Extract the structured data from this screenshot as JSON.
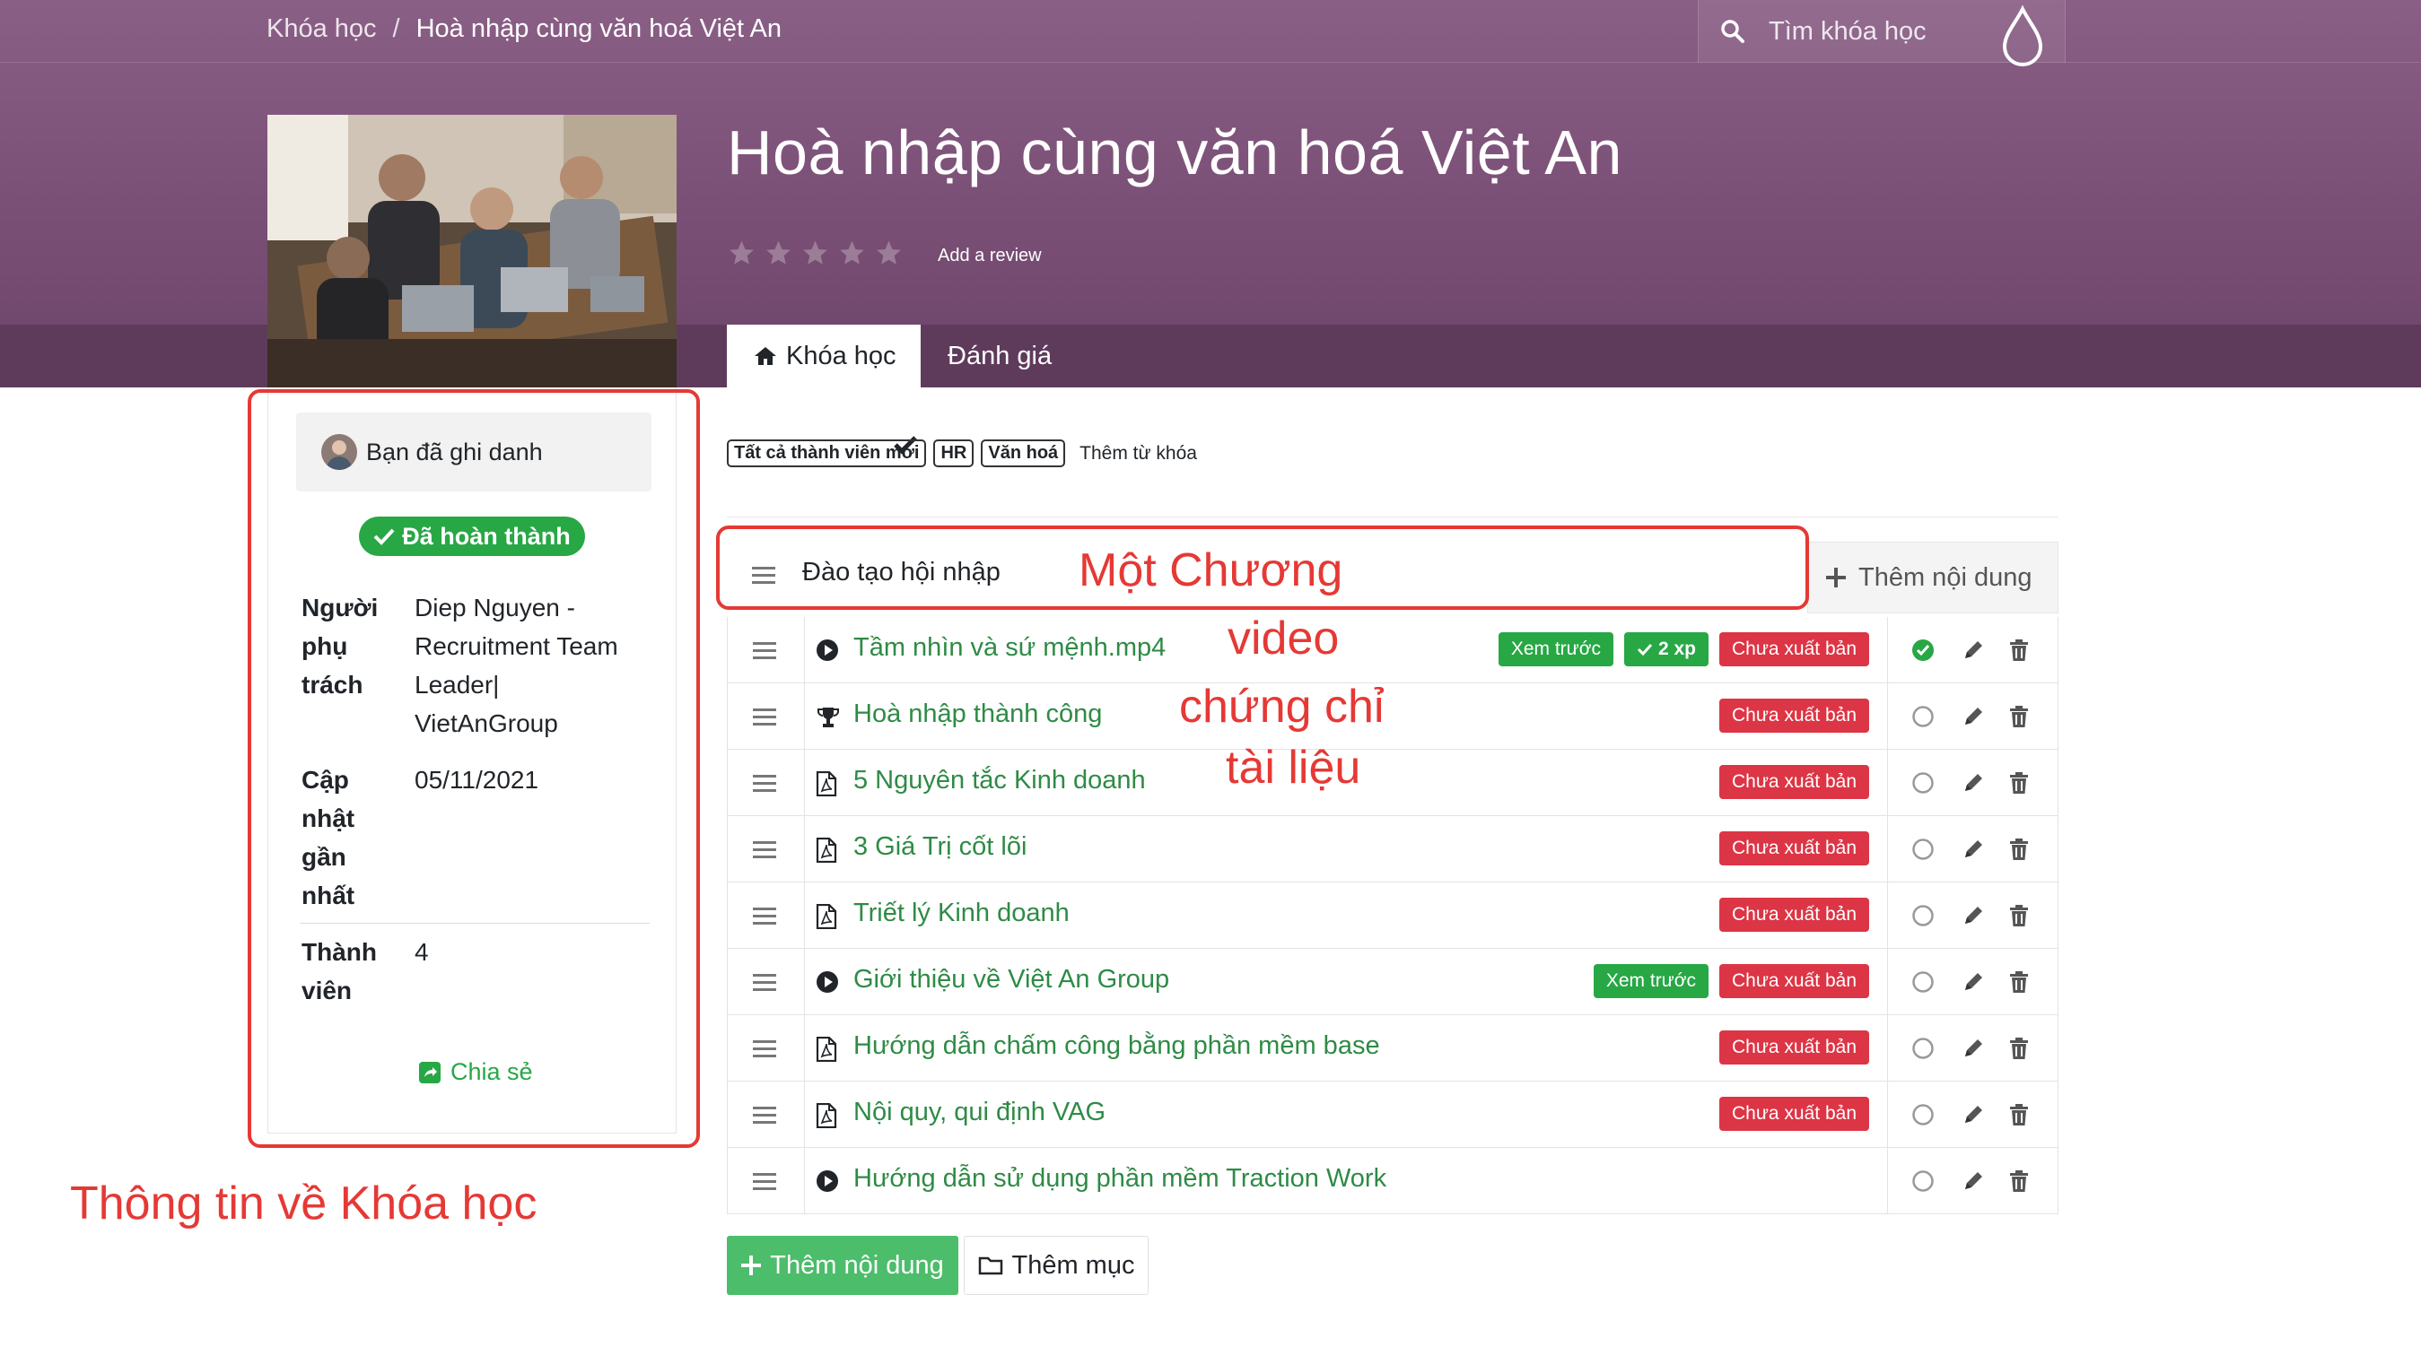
{
  "breadcrumb": {
    "root": "Khóa học",
    "separator": "/",
    "current": "Hoà nhập cùng văn hoá Việt An"
  },
  "search": {
    "placeholder": "Tìm khóa học",
    "icon": "search-icon"
  },
  "course": {
    "title": "Hoà nhập cùng văn hoá Việt An",
    "rating_stars": 0,
    "add_review": "Add a review"
  },
  "tabs": [
    {
      "label": "Khóa học",
      "icon": "home-icon",
      "active": true
    },
    {
      "label": "Đánh giá",
      "active": false
    }
  ],
  "sidebar": {
    "enrolled_label": "Bạn đã ghi danh",
    "completed_label": "Đã hoàn thành",
    "responsible_label_1": "Người",
    "responsible_label_2": "phụ",
    "responsible_label_3": "trách",
    "responsible_value_1": "Diep Nguyen -",
    "responsible_value_2": "Recruitment Team",
    "responsible_value_3": "Leader|",
    "responsible_value_4": "VietAnGroup",
    "updated_label_1": "Cập",
    "updated_label_2": "nhật",
    "updated_label_3": "gần",
    "updated_label_4": "nhất",
    "updated_value": "05/11/2021",
    "members_label_1": "Thành",
    "members_label_2": "viên",
    "members_value": "4",
    "share_label": "Chia sẻ"
  },
  "tags": [
    "Tất cả thành viên mới",
    "HR",
    "Văn hoá"
  ],
  "add_tag_label": "Thêm từ khóa",
  "section": {
    "name": "Đào tạo hội nhập",
    "add_content": "Thêm nội dung"
  },
  "lessons": [
    {
      "icon": "play-circle-icon",
      "title": "Tầm nhìn và sứ mệnh.mp4",
      "preview": "Xem trước",
      "xp": "2 xp",
      "status": "Chưa xuất bản",
      "done": true
    },
    {
      "icon": "trophy-icon",
      "title": "Hoà nhập thành công",
      "status": "Chưa xuất bản",
      "done": false
    },
    {
      "icon": "pdf-file-icon",
      "title": "5 Nguyên tắc Kinh doanh",
      "status": "Chưa xuất bản",
      "done": false
    },
    {
      "icon": "pdf-file-icon",
      "title": "3 Giá Trị cốt lõi",
      "status": "Chưa xuất bản",
      "done": false
    },
    {
      "icon": "pdf-file-icon",
      "title": "Triết lý Kinh doanh",
      "status": "Chưa xuất bản",
      "done": false
    },
    {
      "icon": "play-circle-icon",
      "title": "Giới thiệu về Việt An Group",
      "preview": "Xem trước",
      "status": "Chưa xuất bản",
      "done": false
    },
    {
      "icon": "pdf-file-icon",
      "title": "Hướng dẫn chấm công bằng phần mềm base",
      "status": "Chưa xuất bản",
      "done": false
    },
    {
      "icon": "pdf-file-icon",
      "title": "Nội quy, qui định VAG",
      "status": "Chưa xuất bản",
      "done": false
    },
    {
      "icon": "play-circle-icon",
      "title": "Hướng dẫn sử dụng phần mềm Traction Work",
      "done": false
    }
  ],
  "buttons": {
    "add_content": "Thêm nội dung",
    "add_section": "Thêm mục"
  },
  "annotations": {
    "chapter": "Một Chương",
    "video": "video",
    "certificate": "chứng chỉ",
    "document": "tài liệu",
    "course_info": "Thông tin về Khóa học"
  },
  "colors": {
    "hero": "#7a4f76",
    "success": "#28a745",
    "danger": "#dc3545",
    "annotation": "#e53935"
  }
}
